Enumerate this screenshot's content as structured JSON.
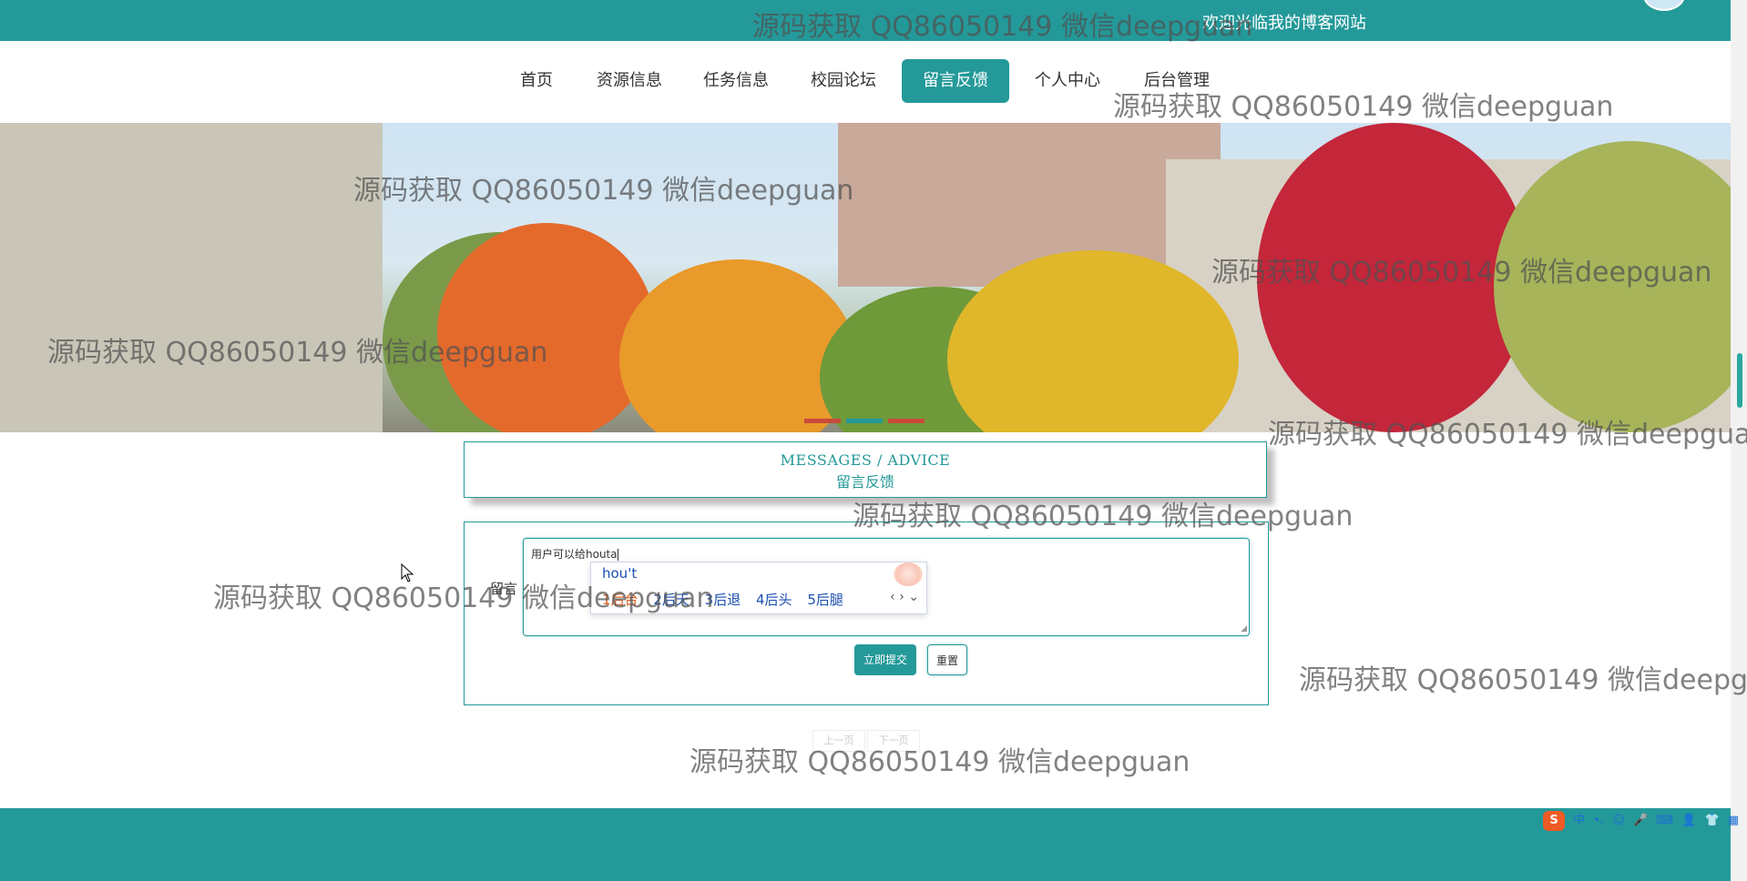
{
  "header": {
    "welcome": "欢迎光临我的博客网站"
  },
  "nav": {
    "items": [
      {
        "label": "首页"
      },
      {
        "label": "资源信息"
      },
      {
        "label": "任务信息"
      },
      {
        "label": "校园论坛"
      },
      {
        "label": "留言反馈",
        "active": true
      },
      {
        "label": "个人中心"
      },
      {
        "label": "后台管理"
      }
    ]
  },
  "section": {
    "title_en": "MESSAGES / ADVICE",
    "title_cn": "留言反馈"
  },
  "form": {
    "label": "留言",
    "textarea_value": "用户可以给houta",
    "submit_label": "立即提交",
    "reset_label": "重置"
  },
  "ime": {
    "composition": "hou't",
    "candidates": [
      "1后台",
      "2后天",
      "3后退",
      "4后头",
      "5后腿"
    ],
    "nav": "‹ › ⌄"
  },
  "pager": {
    "prev": "上一页",
    "next": "下一页"
  },
  "watermark": "源码获取 QQ86050149 微信deepguan",
  "tray": {
    "lang": "中"
  },
  "colors": {
    "brand": "#249999"
  },
  "icons": [
    "avatar-icon",
    "mouse-cursor-icon",
    "sogou-icon",
    "resize-grip-icon"
  ]
}
